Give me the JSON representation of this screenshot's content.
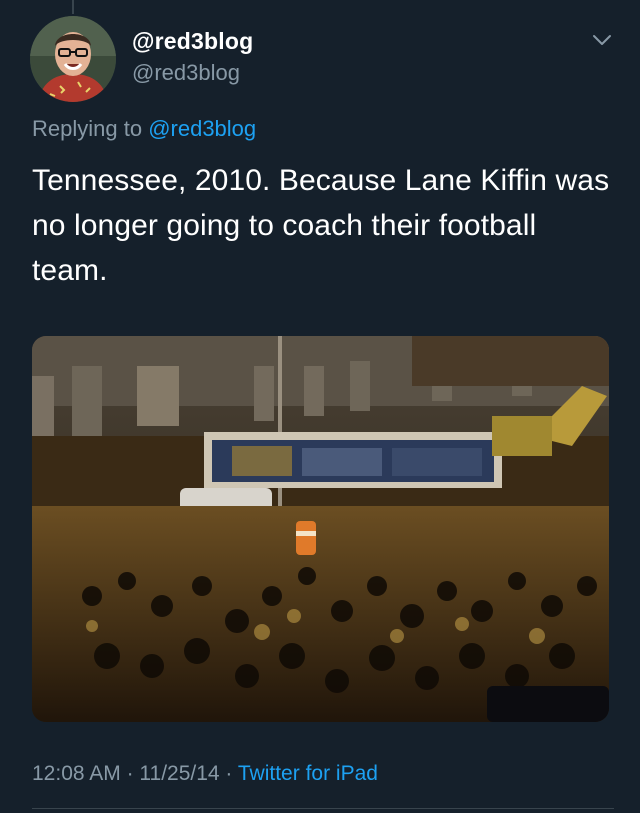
{
  "tweet": {
    "author": {
      "display_name": "@red3blog",
      "handle": "@red3blog",
      "avatar_icon": "avatar-photo"
    },
    "reply": {
      "prefix": "Replying to ",
      "mention": "@red3blog"
    },
    "text": "Tennessee, 2010. Because Lane Kiffin was no longer going to coach their football team.",
    "media": {
      "type": "photo",
      "description_icon": "crowd-photo"
    },
    "meta": {
      "time": "12:08 AM",
      "separator": " · ",
      "date": "11/25/14",
      "source": "Twitter for iPad"
    }
  },
  "colors": {
    "background": "#15202b",
    "secondary_text": "#8899a6",
    "link": "#1da1f2",
    "divider": "#38444d"
  },
  "icons": {
    "menu_caret": "chevron-down-icon"
  }
}
